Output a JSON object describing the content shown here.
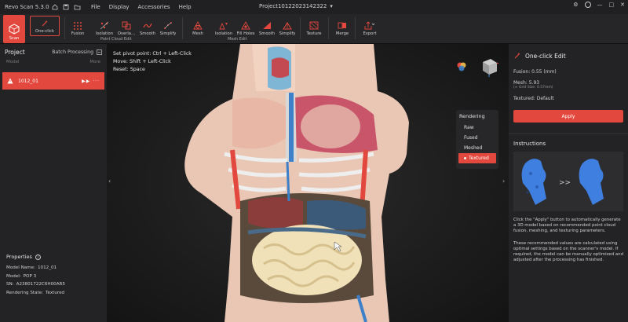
{
  "app": {
    "title": "Revo Scan 5.3.0",
    "project": "Project10122023142322"
  },
  "menu": [
    "File",
    "Display",
    "Accessories",
    "Help"
  ],
  "toolbar": {
    "scan": "Scan",
    "oneclick": "One-click",
    "fusion": "Fusion",
    "isolation": "Isolation",
    "overlap": "Overla…",
    "smooth": "Smooth",
    "simplify": "Simplify",
    "pc_group": "Point Cloud Edit",
    "mesh": "Mesh",
    "mesh_isolation": "Isolation",
    "fill_holes": "Fill Holes",
    "mesh_smooth": "Smooth",
    "mesh_simplify": "Simplify",
    "mesh_group": "Mesh Edit",
    "texture": "Texture",
    "merge": "Merge",
    "export": "Export"
  },
  "left": {
    "title": "Project",
    "batch": "Batch Processing",
    "col_model": "Model",
    "col_more": "More",
    "row_name": "1012_01",
    "props_title": "Properties",
    "props": [
      {
        "k": "Model Name:",
        "v": "1012_01"
      },
      {
        "k": "Model:",
        "v": "POP 3"
      },
      {
        "k": "SN:",
        "v": "A23801722C6H00AR5"
      },
      {
        "k": "Rendering State:",
        "v": "Textured"
      }
    ]
  },
  "viewport": {
    "hint1": "Set pivot point: Ctrl + Left-Click",
    "hint2": "Move: Shift + Left-Click",
    "hint3": "Reset: Space",
    "rendering_title": "Rendering",
    "rendering_opts": [
      "Raw",
      "Fused",
      "Meshed",
      "Textured"
    ],
    "rendering_active": "Textured"
  },
  "right": {
    "title": "One-click Edit",
    "fusion": "Fusion:  0.55 (mm)",
    "mesh": "Mesh:  5.93",
    "grid": "(≈ Grid Size: 0.57mm)",
    "textured": "Textured:  Default",
    "apply": "Apply",
    "instr_title": "Instructions",
    "para1": "Click the \"Apply\" button to automatically generate a 3D model based on recommended point cloud fusion, meshing, and texturing parameters.",
    "para2": "These recommended values are calculated using optimal settings based on the scanner's model. If required, the model can be manually optimized and adjusted after the processing has finished."
  },
  "colors": {
    "accent": "#e2483d",
    "panel": "#232325",
    "bg": "#161616"
  }
}
